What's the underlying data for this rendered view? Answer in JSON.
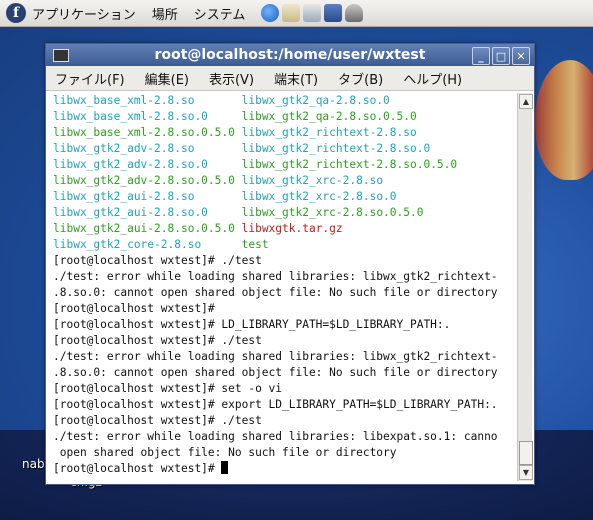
{
  "panel": {
    "menus": [
      "アプリケーション",
      "場所",
      "システム"
    ],
    "launchers": [
      "globe-icon",
      "email-icon",
      "notes-icon",
      "presentation-icon",
      "camera-icon"
    ]
  },
  "desktop": {
    "labels": [
      "nab",
      "ch.gz"
    ]
  },
  "window": {
    "title": "root@localhost:/home/user/wxtest",
    "menu": [
      "ファイル(F)",
      "編集(E)",
      "表示(V)",
      "端末(T)",
      "タブ(B)",
      "ヘルプ(H)"
    ]
  },
  "terminal": {
    "listing": [
      [
        "libwx_base_xml-2.8.so",
        "cyan",
        "libwx_gtk2_qa-2.8.so.0",
        "cyan"
      ],
      [
        "libwx_base_xml-2.8.so.0",
        "cyan",
        "libwx_gtk2_qa-2.8.so.0.5.0",
        "green"
      ],
      [
        "libwx_base_xml-2.8.so.0.5.0",
        "green",
        "libwx_gtk2_richtext-2.8.so",
        "cyan"
      ],
      [
        "libwx_gtk2_adv-2.8.so",
        "cyan",
        "libwx_gtk2_richtext-2.8.so.0",
        "cyan"
      ],
      [
        "libwx_gtk2_adv-2.8.so.0",
        "cyan",
        "libwx_gtk2_richtext-2.8.so.0.5.0",
        "green"
      ],
      [
        "libwx_gtk2_adv-2.8.so.0.5.0",
        "green",
        "libwx_gtk2_xrc-2.8.so",
        "cyan"
      ],
      [
        "libwx_gtk2_aui-2.8.so",
        "cyan",
        "libwx_gtk2_xrc-2.8.so.0",
        "cyan"
      ],
      [
        "libwx_gtk2_aui-2.8.so.0",
        "cyan",
        "libwx_gtk2_xrc-2.8.so.0.5.0",
        "green"
      ],
      [
        "libwx_gtk2_aui-2.8.so.0.5.0",
        "green",
        "libwxgtk.tar.gz",
        "red"
      ],
      [
        "libwx_gtk2_core-2.8.so",
        "cyan",
        "test",
        "green"
      ]
    ],
    "lines": [
      "[root@localhost wxtest]# ./test",
      "./test: error while loading shared libraries: libwx_gtk2_richtext-",
      ".8.so.0: cannot open shared object file: No such file or directory",
      "[root@localhost wxtest]#",
      "[root@localhost wxtest]# LD_LIBRARY_PATH=$LD_LIBRARY_PATH:.",
      "[root@localhost wxtest]# ./test",
      "./test: error while loading shared libraries: libwx_gtk2_richtext-",
      ".8.so.0: cannot open shared object file: No such file or directory",
      "[root@localhost wxtest]# set -o vi",
      "[root@localhost wxtest]# export LD_LIBRARY_PATH=$LD_LIBRARY_PATH:.",
      "[root@localhost wxtest]# ./test",
      "./test: error while loading shared libraries: libexpat.so.1: canno",
      " open shared object file: No such file or directory",
      "[root@localhost wxtest]# "
    ]
  },
  "colors": {
    "cyan": "#1ea4b8",
    "green": "#2ba11f",
    "red": "#c41b1b",
    "titlebar": "#4a6aa3"
  }
}
